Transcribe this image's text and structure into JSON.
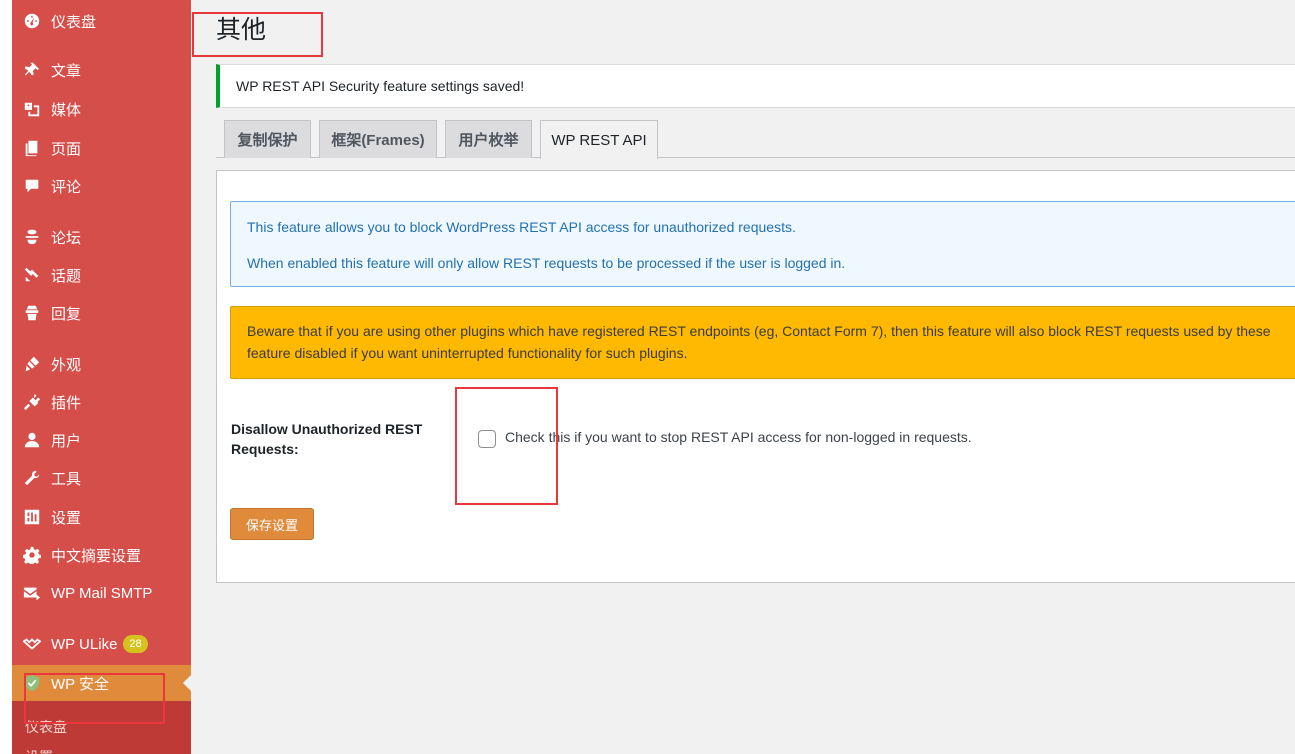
{
  "sidebar": {
    "items": [
      {
        "label": "仪表盘",
        "icon": "dashboard-icon"
      },
      {
        "label": "文章",
        "icon": "pin-icon"
      },
      {
        "label": "媒体",
        "icon": "media-icon"
      },
      {
        "label": "页面",
        "icon": "page-icon"
      },
      {
        "label": "评论",
        "icon": "comment-icon"
      },
      {
        "label": "论坛",
        "icon": "forum-icon"
      },
      {
        "label": "话题",
        "icon": "topic-icon"
      },
      {
        "label": "回复",
        "icon": "reply-icon"
      },
      {
        "label": "外观",
        "icon": "brush-icon"
      },
      {
        "label": "插件",
        "icon": "plugin-icon"
      },
      {
        "label": "用户",
        "icon": "user-icon"
      },
      {
        "label": "工具",
        "icon": "wrench-icon"
      },
      {
        "label": "设置",
        "icon": "settings-icon"
      },
      {
        "label": "中文摘要设置",
        "icon": "gear-icon"
      },
      {
        "label": "WP Mail SMTP",
        "icon": "mail-icon"
      },
      {
        "label": "WP ULike",
        "icon": "ulike-icon",
        "badge": "28"
      },
      {
        "label": "WP 安全",
        "icon": "shield-icon",
        "active": true
      }
    ],
    "submenu": [
      "仪表盘",
      "设置"
    ]
  },
  "page": {
    "title": "其他",
    "notice": "WP REST API Security feature settings saved!",
    "tabs": [
      "复制保护",
      "框架(Frames)",
      "用户枚举",
      "WP REST API"
    ],
    "active_tab": "WP REST API",
    "info_lines": [
      "This feature allows you to block WordPress REST API access for unauthorized requests.",
      "When enabled this feature will only allow REST requests to be processed if the user is logged in."
    ],
    "warning_lines": [
      "Beware that if you are using other plugins which have registered REST endpoints (eg, Contact Form 7), then this feature will also block REST requests used by these",
      "feature disabled if you want uninterrupted functionality for such plugins."
    ],
    "field_label": "Disallow Unauthorized REST Requests:",
    "checkbox_checked": false,
    "checkbox_description": "Check this if you want to stop REST API access for non-logged in requests.",
    "save_button": "保存设置"
  },
  "colors": {
    "sidebar": "#d54e4a",
    "active_menu": "#e08a3c",
    "notice_border": "#00a32a",
    "info_text": "#2271b1",
    "warning_bg": "#ffb900",
    "highlight": "#e8383d"
  }
}
